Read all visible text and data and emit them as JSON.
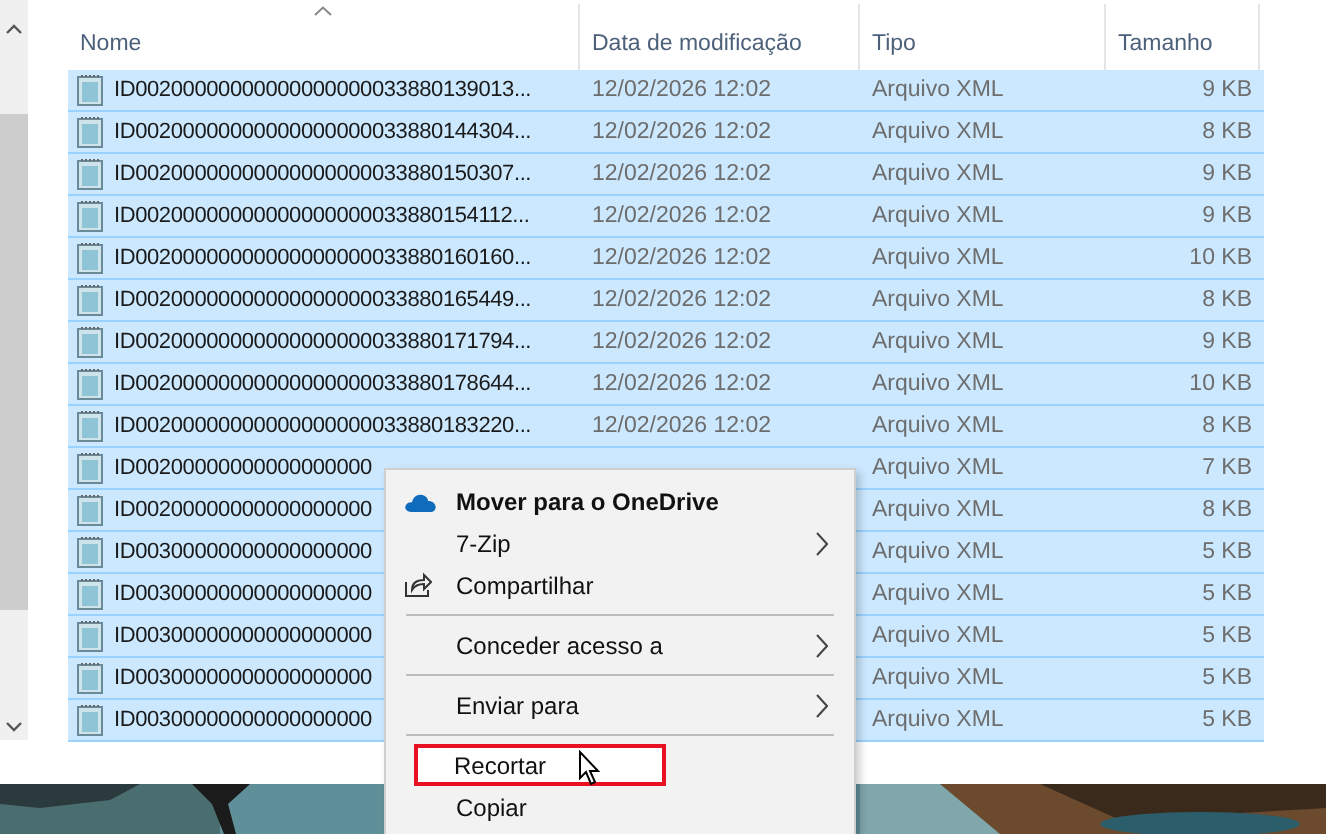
{
  "columns": [
    {
      "label": "Nome",
      "sorted": true
    },
    {
      "label": "Data de modificação",
      "sorted": false
    },
    {
      "label": "Tipo",
      "sorted": false
    },
    {
      "label": "Tamanho",
      "sorted": false
    }
  ],
  "rows": [
    {
      "name": "ID00200000000000000000033880139013...",
      "date": "12/02/2026 12:02",
      "type": "Arquivo XML",
      "size": "9 KB",
      "selected": true
    },
    {
      "name": "ID00200000000000000000033880144304...",
      "date": "12/02/2026 12:02",
      "type": "Arquivo XML",
      "size": "8 KB",
      "selected": true
    },
    {
      "name": "ID00200000000000000000033880150307...",
      "date": "12/02/2026 12:02",
      "type": "Arquivo XML",
      "size": "9 KB",
      "selected": true
    },
    {
      "name": "ID00200000000000000000033880154112...",
      "date": "12/02/2026 12:02",
      "type": "Arquivo XML",
      "size": "9 KB",
      "selected": true
    },
    {
      "name": "ID00200000000000000000033880160160...",
      "date": "12/02/2026 12:02",
      "type": "Arquivo XML",
      "size": "10 KB",
      "selected": true
    },
    {
      "name": "ID00200000000000000000033880165449...",
      "date": "12/02/2026 12:02",
      "type": "Arquivo XML",
      "size": "8 KB",
      "selected": true
    },
    {
      "name": "ID00200000000000000000033880171794...",
      "date": "12/02/2026 12:02",
      "type": "Arquivo XML",
      "size": "9 KB",
      "selected": true
    },
    {
      "name": "ID00200000000000000000033880178644...",
      "date": "12/02/2026 12:02",
      "type": "Arquivo XML",
      "size": "10 KB",
      "selected": true
    },
    {
      "name": "ID00200000000000000000033880183220...",
      "date": "12/02/2026 12:02",
      "type": "Arquivo XML",
      "size": "8 KB",
      "selected": true
    },
    {
      "name": "ID00200000000000000000",
      "type": "Arquivo XML",
      "size": "7 KB",
      "selected": true
    },
    {
      "name": "ID00200000000000000000",
      "type": "Arquivo XML",
      "size": "8 KB",
      "selected": true
    },
    {
      "name": "ID00300000000000000000",
      "type": "Arquivo XML",
      "size": "5 KB",
      "selected": true
    },
    {
      "name": "ID00300000000000000000",
      "type": "Arquivo XML",
      "size": "5 KB",
      "selected": true
    },
    {
      "name": "ID00300000000000000000",
      "type": "Arquivo XML",
      "size": "5 KB",
      "selected": true
    },
    {
      "name": "ID00300000000000000000",
      "type": "Arquivo XML",
      "size": "5 KB",
      "selected": true
    },
    {
      "name": "ID00300000000000000000",
      "type": "Arquivo XML",
      "size": "5 KB",
      "selected": true
    }
  ],
  "context_menu": [
    {
      "kind": "onedrive",
      "label": "Mover para o OneDrive",
      "submenu": false,
      "hovered": false
    },
    {
      "kind": "plain",
      "label": "7-Zip",
      "submenu": true,
      "hovered": false
    },
    {
      "kind": "share",
      "label": "Compartilhar",
      "submenu": false,
      "hovered": false
    },
    {
      "kind": "separator"
    },
    {
      "kind": "plain",
      "label": "Conceder acesso a",
      "submenu": true,
      "hovered": false
    },
    {
      "kind": "separator"
    },
    {
      "kind": "plain",
      "label": "Enviar para",
      "submenu": true,
      "hovered": false
    },
    {
      "kind": "separator"
    },
    {
      "kind": "plain",
      "label": "Recortar",
      "submenu": false,
      "hovered": true,
      "highlighted": true
    },
    {
      "kind": "plain",
      "label": "Copiar",
      "submenu": false,
      "hovered": false
    }
  ]
}
